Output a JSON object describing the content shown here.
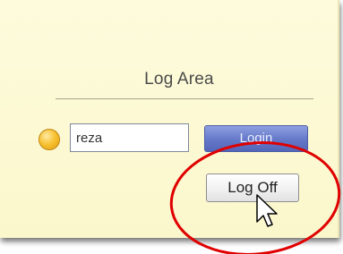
{
  "panel": {
    "title": "Log Area"
  },
  "login_form": {
    "username_value": "reza",
    "login_label": "Login",
    "logoff_label": "Log Off"
  },
  "status_indicator": {
    "icon": "status-dot-icon",
    "color": "#f7c130"
  },
  "annotation": {
    "icon": "highlight-ellipse",
    "color": "#e00000"
  },
  "cursor": {
    "icon": "arrow-cursor-icon"
  },
  "colors": {
    "panel_background": "#fcf8d2",
    "login_button": "#6478c9",
    "logoff_button": "#f1f1f1"
  }
}
